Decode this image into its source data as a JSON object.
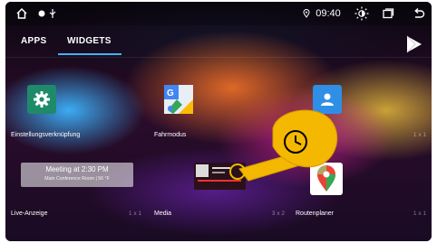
{
  "status": {
    "time": "09:40"
  },
  "tabs": [
    {
      "label": "APPS"
    },
    {
      "label": "WIDGETS"
    }
  ],
  "widgets": [
    {
      "label": "Einstellungsverknüpfung",
      "size": "",
      "icon": "settings-gear-icon",
      "color": "#1e8a6a"
    },
    {
      "label": "Fahrmodus",
      "size": "",
      "icon": "google-maps-directions-icon",
      "color": "#4285f4"
    },
    {
      "label": "Kontakt",
      "size": "1 x 1",
      "icon": "contact-person-icon",
      "color": "#2f8fe6"
    },
    {
      "label": "Live-Anzeige",
      "size": "1 x 1",
      "icon": "",
      "color": ""
    },
    {
      "label": "Media",
      "size": "3 x 2",
      "icon": "media-player-icon",
      "color": ""
    },
    {
      "label": "Routenplaner",
      "size": "1 x 1",
      "icon": "google-maps-pin-icon",
      "color": "#ffffff"
    }
  ],
  "meeting_preview": {
    "title": "Meeting at 2:30 PM",
    "subtitle": "Main Conference Room | 56 °F"
  },
  "colors": {
    "accent": "#3fb3ff",
    "clock_badge": "#f5b800"
  }
}
